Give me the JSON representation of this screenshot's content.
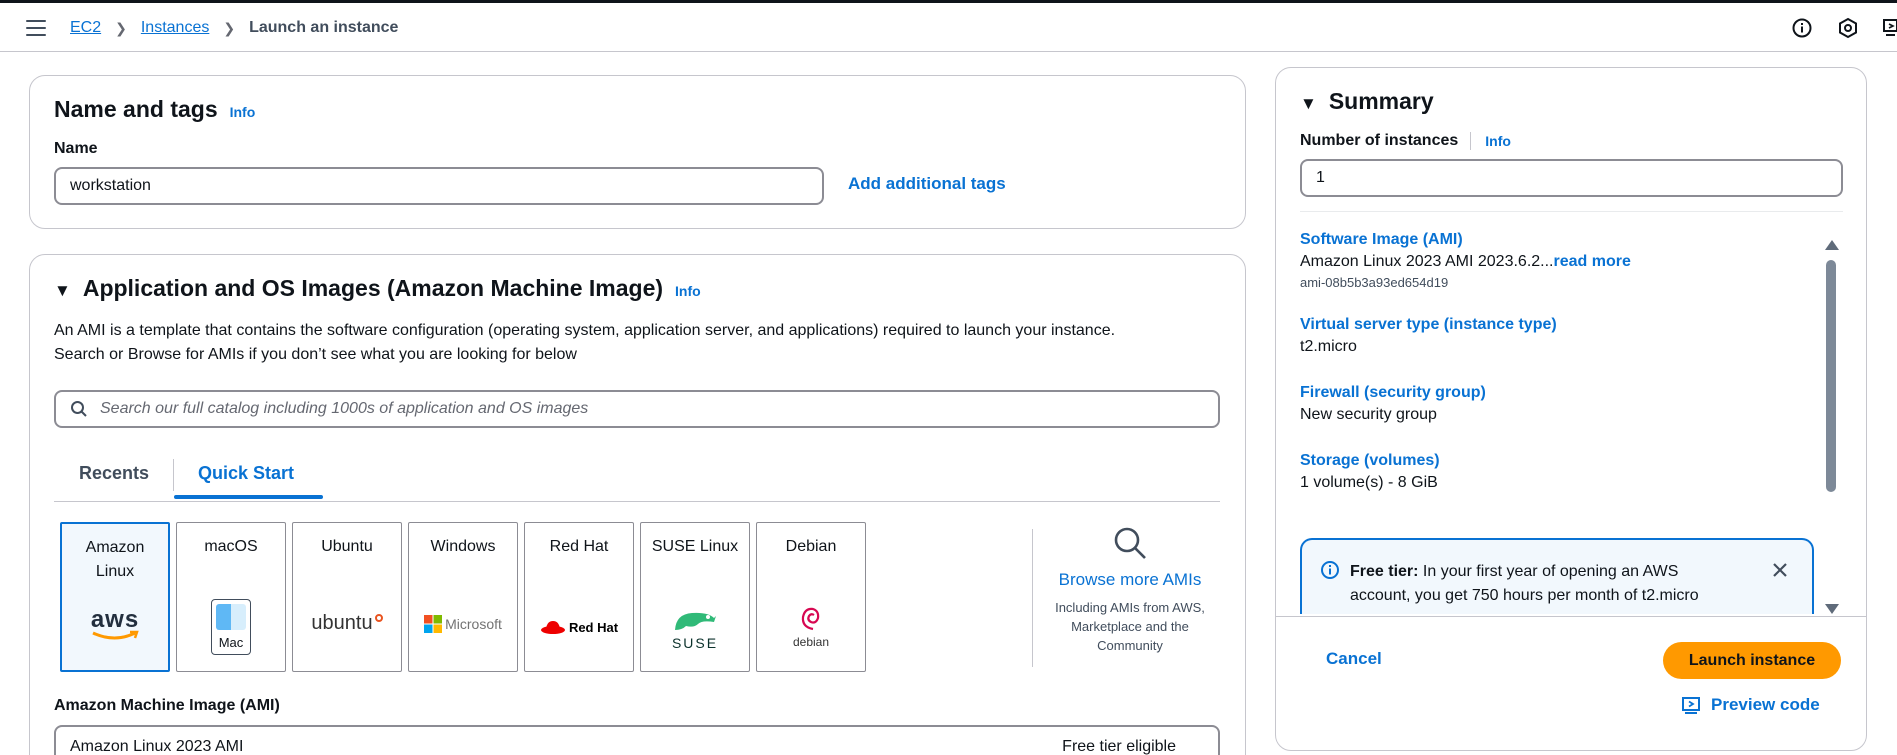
{
  "breadcrumb": {
    "ec2": "EC2",
    "instances": "Instances",
    "current": "Launch an instance"
  },
  "name_tags": {
    "title": "Name and tags",
    "info": "Info",
    "name_label": "Name",
    "name_value": "workstation",
    "add_tags": "Add additional tags"
  },
  "ami": {
    "title": "Application and OS Images (Amazon Machine Image)",
    "info": "Info",
    "description_line1": "An AMI is a template that contains the software configuration (operating system, application server, and applications) required to launch your instance.",
    "description_line2": "Search or Browse for AMIs if you don’t see what you are looking for below",
    "search_placeholder": "Search our full catalog including 1000s of application and OS images",
    "tabs": [
      "Recents",
      "Quick Start"
    ],
    "tiles": [
      {
        "name": "Amazon Linux",
        "logo_text": "aws"
      },
      {
        "name": "macOS",
        "logo_text": "Mac"
      },
      {
        "name": "Ubuntu",
        "logo_text": "ubuntu"
      },
      {
        "name": "Windows",
        "logo_text": "Microsoft"
      },
      {
        "name": "Red Hat",
        "logo_text": "Red Hat"
      },
      {
        "name": "SUSE Linux",
        "logo_text": "SUSE"
      },
      {
        "name": "Debian",
        "logo_text": "debian"
      }
    ],
    "browse_more": "Browse more AMIs",
    "browse_more_sub": "Including AMIs from AWS, Marketplace and the Community",
    "ami_label": "Amazon Machine Image (AMI)",
    "ami_selected": "Amazon Linux 2023 AMI",
    "ami_badge": "Free tier eligible"
  },
  "summary": {
    "title": "Summary",
    "num_instances_label": "Number of instances",
    "info": "Info",
    "num_instances_value": "1",
    "software_image_label": "Software Image (AMI)",
    "software_image_value": "Amazon Linux 2023 AMI 2023.6.2...",
    "read_more": "read more",
    "ami_id": "ami-08b5b3a93ed654d19",
    "instance_type_label": "Virtual server type (instance type)",
    "instance_type_value": "t2.micro",
    "firewall_label": "Firewall (security group)",
    "firewall_value": "New security group",
    "storage_label": "Storage (volumes)",
    "storage_value": "1 volume(s) - 8 GiB",
    "free_tier_bold": "Free tier:",
    "free_tier_text1": " In your first year of opening an AWS",
    "free_tier_text2": "account, you get 750 hours per month of t2.micro",
    "cancel": "Cancel",
    "launch": "Launch instance",
    "preview_code": "Preview code"
  },
  "colors": {
    "accent": "#0972d3",
    "primary_button": "#ff9900",
    "border": "#c6c6cd"
  }
}
